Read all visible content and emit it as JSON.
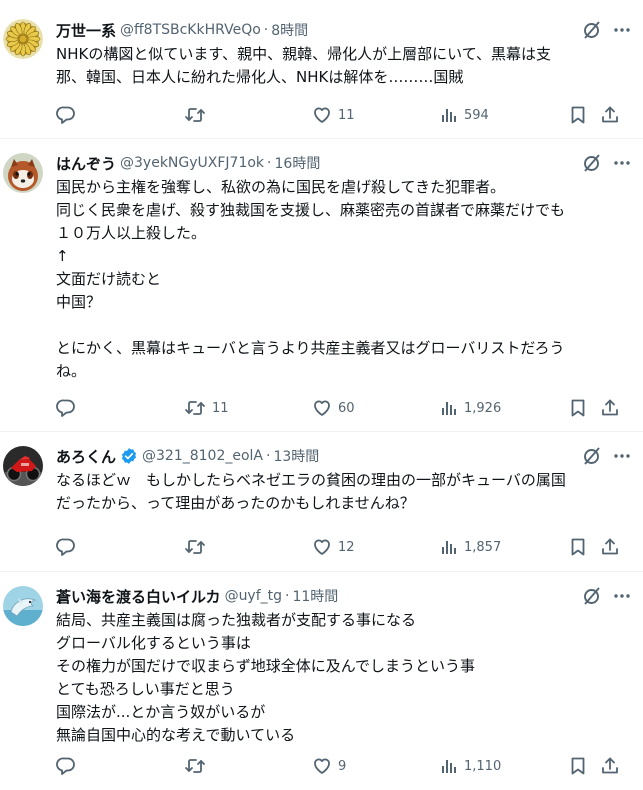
{
  "tweets": [
    {
      "name": "万世一系",
      "verified": false,
      "handle": "@ff8TSBcKkHRVeQo",
      "dot": "·",
      "time": "8時間",
      "lines": [
        "NHKの構図と似ています、親中、親韓、帰化人が上層部にいて、黒幕は支",
        "那、韓国、日本人に紛れた帰化人、NHKは解体を………国賊"
      ],
      "replies": "",
      "retweets": "",
      "likes": "11",
      "views": "594",
      "avatar_icon": "chrysanthemum-seal-icon"
    },
    {
      "name": "はんぞう",
      "verified": false,
      "handle": "@3yekNGyUXFJ71ok",
      "dot": "·",
      "time": "16時間",
      "lines": [
        "国民から主権を強奪し、私欲の為に国民を虐げ殺してきた犯罪者。",
        "同じく民衆を虐げ、殺す独裁国を支援し、麻薬密売の首謀者で麻薬だけでも",
        "１０万人以上殺した。",
        "↑",
        "文面だけ読むと",
        "中国？",
        "",
        "とにかく、黒幕はキューバと言うより共産主義者又はグローバリストだろう",
        "ね。"
      ],
      "replies": "",
      "retweets": "11",
      "likes": "60",
      "views": "1,926",
      "avatar_icon": "red-panda-avatar-icon"
    },
    {
      "name": "あろくん",
      "verified": true,
      "handle": "@321_8102_eolA",
      "dot": "·",
      "time": "13時間",
      "lines": [
        "なるほどｗ　もしかしたらベネゼエラの貧困の理由の一部がキューバの属国",
        "だったから、って理由があったのかもしれませんね？"
      ],
      "replies": "",
      "retweets": "",
      "likes": "12",
      "views": "1,857",
      "avatar_icon": "red-motorcycle-avatar-icon"
    },
    {
      "name": "蒼い海を渡る白いイルカ",
      "verified": false,
      "handle": "@uyf_tg",
      "dot": "·",
      "time": "11時間",
      "lines": [
        "結局、共産主義国は腐った独裁者が支配する事になる",
        "グローバル化するという事は",
        "その権力が国だけで収まらず地球全体に及んでしまうという事",
        "とても恐ろしい事だと思う",
        "国際法が...とか言う奴がいるが",
        "無論自国中心的な考えで動いている"
      ],
      "replies": "",
      "retweets": "",
      "likes": "9",
      "views": "1,110",
      "avatar_icon": "dolphin-avatar-icon"
    }
  ],
  "colors": {
    "text": "#0f1419",
    "muted": "#536471",
    "divider": "#eff3f4",
    "verified": "#1d9bf0"
  }
}
